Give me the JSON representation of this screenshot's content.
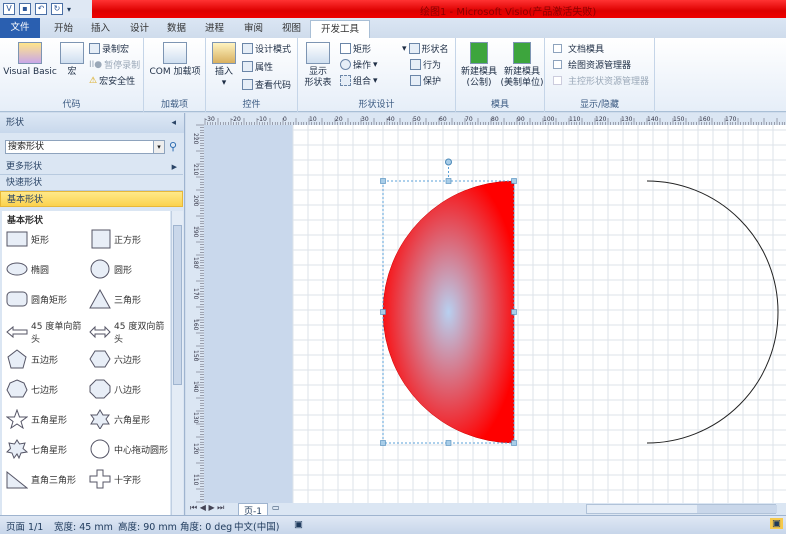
{
  "window": {
    "title": "绘图1 - Microsoft Visio(产品激活失败)"
  },
  "qat": {
    "icons": [
      "visio-icon",
      "save-icon",
      "undo-icon",
      "redo-icon",
      "customize-icon"
    ]
  },
  "tabs": [
    {
      "label": "文件"
    },
    {
      "label": "开始"
    },
    {
      "label": "插入"
    },
    {
      "label": "设计"
    },
    {
      "label": "数据"
    },
    {
      "label": "进程"
    },
    {
      "label": "审阅"
    },
    {
      "label": "视图"
    },
    {
      "label": "开发工具"
    }
  ],
  "ribbon": {
    "code": {
      "label": "代码",
      "visual_basic": "Visual Basic",
      "macro": "宏",
      "record": "录制宏",
      "pause": "暂停录制",
      "security": "宏安全性"
    },
    "addins": {
      "label": "加载项",
      "com": "COM 加载项"
    },
    "controls": {
      "label": "控件",
      "insert": "插入",
      "design_mode": "设计模式",
      "properties": "属性",
      "view_code": "查看代码"
    },
    "shape_design": {
      "label": "形状设计",
      "show_sheet_1": "显示",
      "show_sheet_2": "形状表",
      "rect": "矩形",
      "operations": "操作",
      "group": "组合",
      "shape_name": "形状名",
      "behavior": "行为",
      "protect": "保护"
    },
    "stencil": {
      "label": "模具",
      "new_metric_1": "新建模具",
      "new_metric_2": "(公制)",
      "new_us_1": "新建模具",
      "new_us_2": "(美制单位)"
    },
    "show_hide": {
      "label": "显示/隐藏",
      "doc_stencil": "文档模具",
      "drawing_explorer": "绘图资源管理器",
      "master_explorer": "主控形状资源管理器"
    }
  },
  "shapes_panel": {
    "title": "形状",
    "search_placeholder": "搜索形状",
    "more": "更多形状",
    "quick": "快速形状",
    "basic": "基本形状",
    "stencil_title": "基本形状",
    "items": [
      {
        "label": "矩形"
      },
      {
        "label": "正方形"
      },
      {
        "label": "椭圆"
      },
      {
        "label": "圆形"
      },
      {
        "label": "圆角矩形"
      },
      {
        "label": "三角形"
      },
      {
        "label": "45 度单向箭头"
      },
      {
        "label": "45 度双向箭头"
      },
      {
        "label": "五边形"
      },
      {
        "label": "六边形"
      },
      {
        "label": "七边形"
      },
      {
        "label": "八边形"
      },
      {
        "label": "五角星形"
      },
      {
        "label": "六角星形"
      },
      {
        "label": "七角星形"
      },
      {
        "label": "中心拖动圆形"
      },
      {
        "label": "直角三角形"
      },
      {
        "label": "十字形"
      }
    ]
  },
  "page_tabs": {
    "page": "页-1"
  },
  "status": {
    "page": "页面 1/1",
    "width": "宽度: 45 mm",
    "height": "高度: 90 mm",
    "angle": "角度: 0 deg",
    "lang": "中文(中国)"
  },
  "ruler": {
    "h_labels": [
      "-30",
      "-20",
      "-10",
      "0",
      "10",
      "20",
      "30",
      "40",
      "50",
      "60",
      "70",
      "80",
      "90",
      "100",
      "110",
      "120",
      "130",
      "140",
      "150",
      "160",
      "170"
    ],
    "v_labels": [
      "220",
      "210",
      "200",
      "190",
      "180",
      "170",
      "160",
      "150",
      "140",
      "130",
      "120",
      "110"
    ]
  },
  "colors": {
    "shape_fill": "#ff0000",
    "shape_highlight": "#b8d0f0",
    "selection": "#5aa0d8"
  }
}
